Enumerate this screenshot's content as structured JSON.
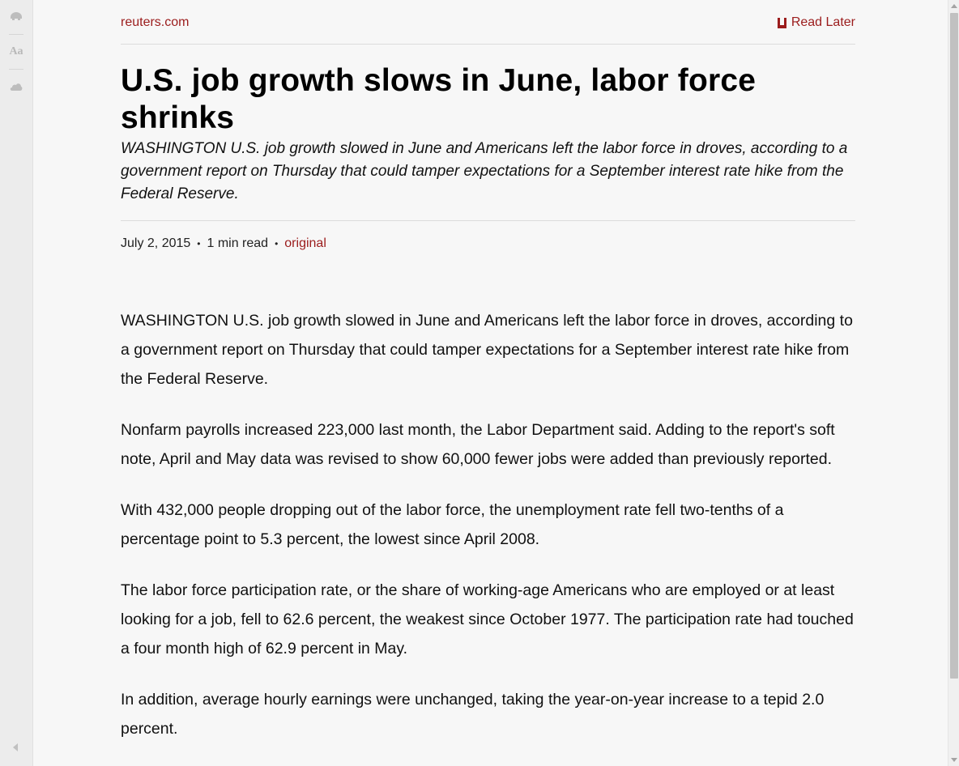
{
  "toolbar": {
    "icons": [
      "pocket-icon",
      "font-settings-icon",
      "cloud-icon"
    ],
    "font_label": "Aa"
  },
  "article": {
    "source": "reuters.com",
    "read_later": "Read Later",
    "title": "U.S. job growth slows in June, labor force shrinks",
    "dek": "WASHINGTON U.S. job growth slowed in June and Americans left the labor force in droves, according to a government report on Thursday that could tamper expectations for a September interest rate hike from the Federal Reserve.",
    "meta": {
      "date": "July 2, 2015",
      "sep": "•",
      "read_time": "1 min read",
      "original": "original"
    },
    "paragraphs": [
      "WASHINGTON U.S. job growth slowed in June and Americans left the labor force in droves, according to a government report on Thursday that could tamper expectations for a September interest rate hike from the Federal Reserve.",
      "Nonfarm payrolls increased 223,000 last month, the Labor Department said. Adding to the report's soft note, April and May data was revised to show 60,000 fewer jobs were added than previously reported.",
      "With 432,000 people dropping out of the labor force, the unemployment rate fell two-tenths of a percentage point to 5.3 percent, the lowest since April 2008.",
      "The labor force participation rate, or the share of working-age Americans who are employed or at least looking for a job, fell to 62.6 percent, the weakest since October 1977. The participation rate had touched a four month high of 62.9 percent in May.",
      "In addition, average hourly earnings were unchanged, taking the year-on-year increase to a tepid 2.0 percent."
    ]
  },
  "colors": {
    "accent": "#9b1c1c",
    "background": "#f7f7f7",
    "toolbar": "#ececec"
  }
}
